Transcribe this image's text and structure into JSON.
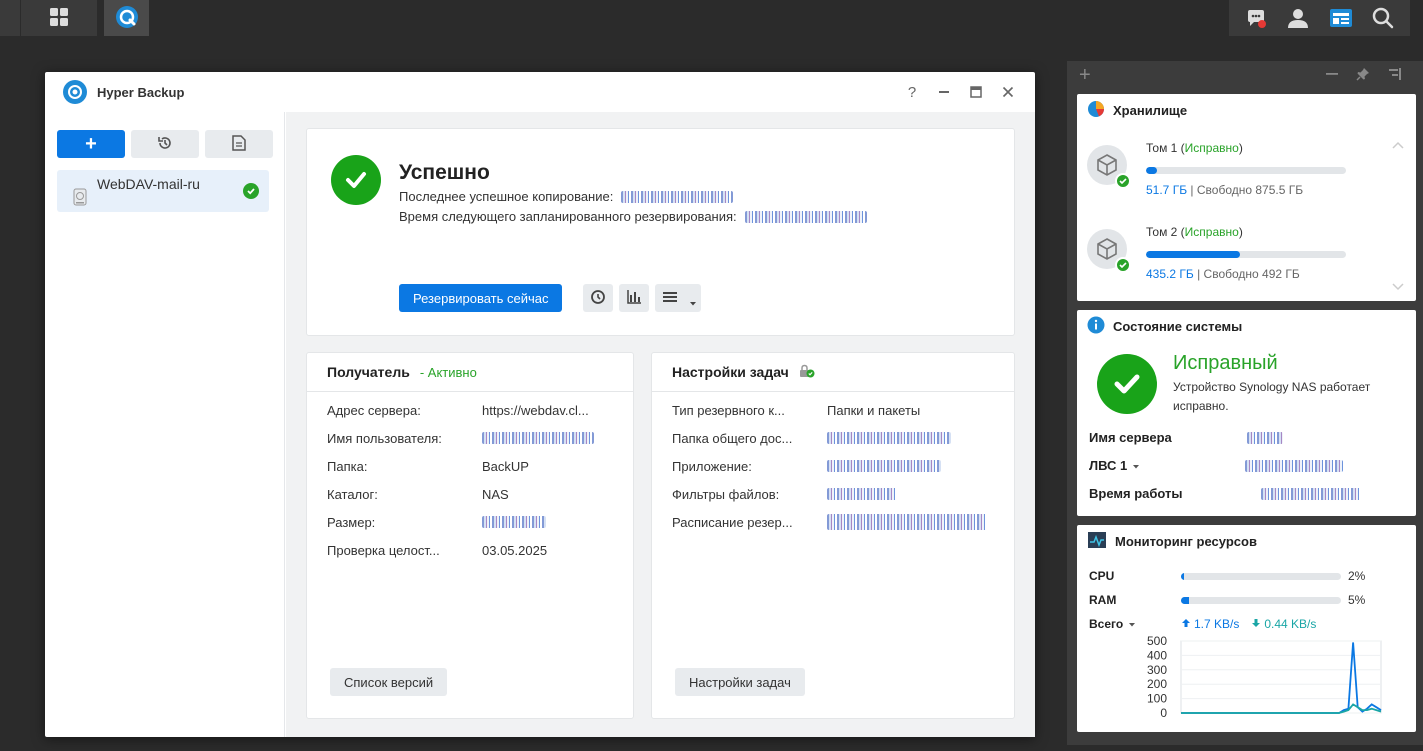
{
  "window": {
    "title": "Hyper Backup",
    "help": "?"
  },
  "sidebar": {
    "add_label": "+",
    "task_name": "WebDAV-mail-ru"
  },
  "status": {
    "title": "Успешно",
    "last_backup_label": "Последнее успешное копирование:",
    "next_backup_label": "Время следующего запланированного резервирования:",
    "backup_now_label": "Резервировать сейчас"
  },
  "target": {
    "title": "Получатель",
    "state": "- Активно",
    "rows": [
      {
        "key": "Адрес сервера:",
        "value": "https://webdav.cl..."
      },
      {
        "key": "Имя пользователя:",
        "value": ""
      },
      {
        "key": "Папка:",
        "value": "BackUP"
      },
      {
        "key": "Каталог:",
        "value": "NAS"
      },
      {
        "key": "Размер:",
        "value": ""
      },
      {
        "key": "Проверка целост...",
        "value": "03.05.2025"
      }
    ],
    "versions_btn": "Список версий"
  },
  "settings": {
    "title": "Настройки задач",
    "rows": [
      {
        "key": "Тип резервного к...",
        "value": "Папки и пакеты"
      },
      {
        "key": "Папка общего дос...",
        "value": ""
      },
      {
        "key": "Приложение:",
        "value": ""
      },
      {
        "key": "Фильтры файлов:",
        "value": ""
      },
      {
        "key": "Расписание резер...",
        "value": ""
      }
    ],
    "settings_btn": "Настройки задач"
  },
  "widgets": {
    "storage": {
      "title": "Хранилище",
      "volumes": [
        {
          "name": "Том 1",
          "status": "Исправно",
          "used": "51.7 ГБ",
          "free": "Свободно 875.5 ГБ",
          "fill": 0.053
        },
        {
          "name": "Том 2",
          "status": "Исправно",
          "used": "435.2 ГБ",
          "free": "Свободно 492 ГБ",
          "fill": 0.47
        }
      ]
    },
    "health": {
      "title": "Состояние системы",
      "state": "Исправный",
      "desc": "Устройство Synology NAS работает исправно.",
      "server_label": "Имя сервера",
      "lan_label": "ЛВС 1",
      "uptime_label": "Время работы"
    },
    "monitor": {
      "title": "Мониторинг ресурсов",
      "cpu_label": "CPU",
      "cpu_pct": "2%",
      "cpu_fill": 0.02,
      "ram_label": "RAM",
      "ram_pct": "5%",
      "ram_fill": 0.05,
      "total_label": "Всего",
      "up": "1.7 KB/s",
      "down": "0.44 KB/s"
    }
  },
  "chart_data": {
    "type": "line",
    "title": "",
    "ylim": [
      0,
      500
    ],
    "yticks": [
      "500",
      "400",
      "300",
      "200",
      "100",
      "0"
    ],
    "series": [
      {
        "values": [
          0,
          0,
          0,
          0,
          0,
          0,
          0,
          0,
          0,
          0,
          0,
          0,
          0,
          0,
          0,
          0,
          0,
          0,
          0,
          0,
          0,
          0,
          0,
          0,
          0,
          0,
          0,
          0,
          0,
          0,
          0,
          0,
          0,
          0,
          0,
          20,
          30,
          490,
          40,
          10,
          30,
          60,
          40,
          20
        ]
      },
      {
        "values": [
          0,
          0,
          0,
          0,
          0,
          0,
          0,
          0,
          0,
          0,
          0,
          0,
          0,
          0,
          0,
          0,
          0,
          0,
          0,
          0,
          0,
          0,
          0,
          0,
          0,
          0,
          0,
          0,
          0,
          0,
          0,
          0,
          0,
          0,
          0,
          10,
          20,
          60,
          40,
          20,
          20,
          30,
          20,
          10
        ]
      }
    ],
    "colors": [
      "#0b78e3",
      "#1aa6a6"
    ]
  }
}
